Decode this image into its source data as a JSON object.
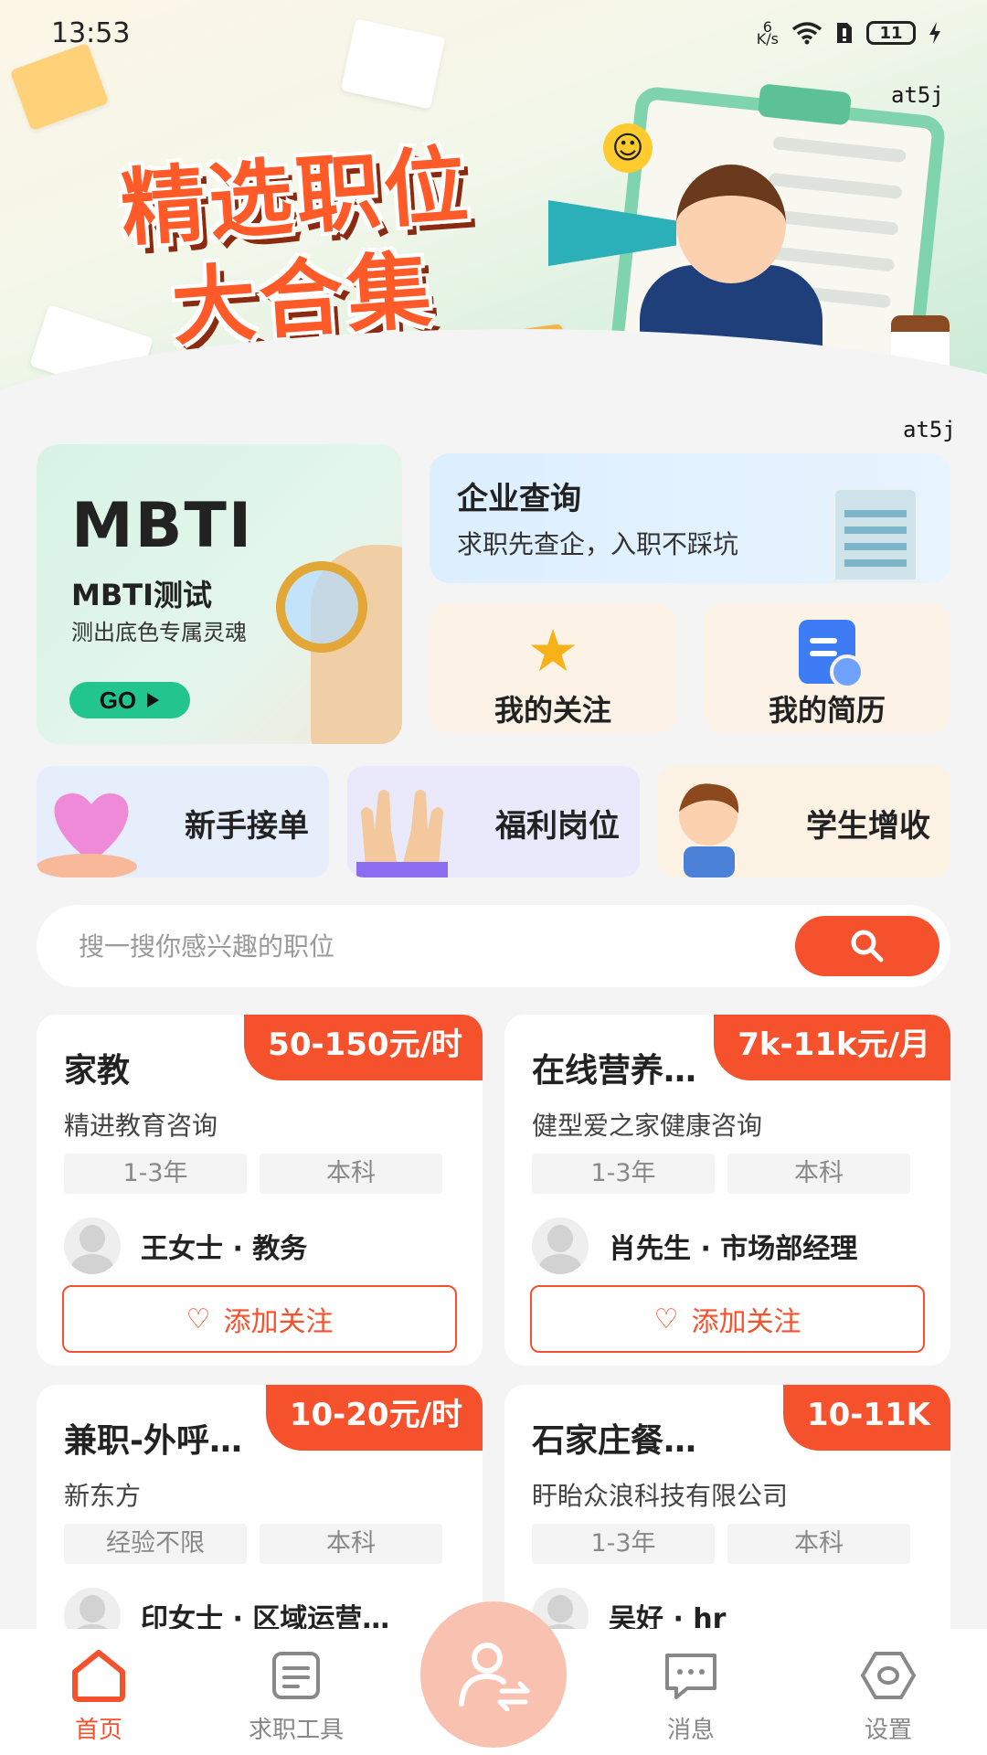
{
  "status_bar": {
    "time": "13:53",
    "net_speed_top": "6",
    "net_speed_unit": "K/s",
    "battery": "11"
  },
  "banner": {
    "title_line1": "精选职位",
    "title_line2": "大合集",
    "watermark": "at5j"
  },
  "mbti_card": {
    "title": "MBTI",
    "subtitle": "MBTI测试",
    "desc": "测出底色专属灵魂",
    "go_label": "GO"
  },
  "company_card": {
    "title": "企业查询",
    "desc": "求职先查企，入职不踩坑"
  },
  "quick_links": [
    {
      "label": "我的关注",
      "icon": "star-icon"
    },
    {
      "label": "我的简历",
      "icon": "resume-icon"
    }
  ],
  "category_strips": [
    {
      "label": "新手接单"
    },
    {
      "label": "福利岗位"
    },
    {
      "label": "学生增收"
    }
  ],
  "search": {
    "placeholder": "搜一搜你感兴趣的职位"
  },
  "jobs": [
    {
      "title": "家教",
      "salary": "50-150元/时",
      "company": "精进教育咨询",
      "experience": "1-3年",
      "education": "本科",
      "contact": "王女士 · 教务",
      "follow_label": "添加关注"
    },
    {
      "title": "在线营养…",
      "salary": "7k-11k元/月",
      "company": "健型爱之家健康咨询",
      "experience": "1-3年",
      "education": "本科",
      "contact": "肖先生 · 市场部经理",
      "follow_label": "添加关注"
    },
    {
      "title": "兼职-外呼…",
      "salary": "10-20元/时",
      "company": "新东方",
      "experience": "经验不限",
      "education": "本科",
      "contact": "印女士 · 区域运营…"
    },
    {
      "title": "石家庄餐…",
      "salary": "10-11K",
      "company": "盱眙众浪科技有限公司",
      "experience": "1-3年",
      "education": "本科",
      "contact": "吴好 · hr"
    }
  ],
  "bottom_nav": [
    {
      "label": "首页",
      "active": true
    },
    {
      "label": "求职工具",
      "active": false
    },
    {
      "label": "消息",
      "active": false
    },
    {
      "label": "设置",
      "active": false
    }
  ],
  "colors": {
    "accent": "#f4512c",
    "mbti_go": "#23c58e"
  }
}
